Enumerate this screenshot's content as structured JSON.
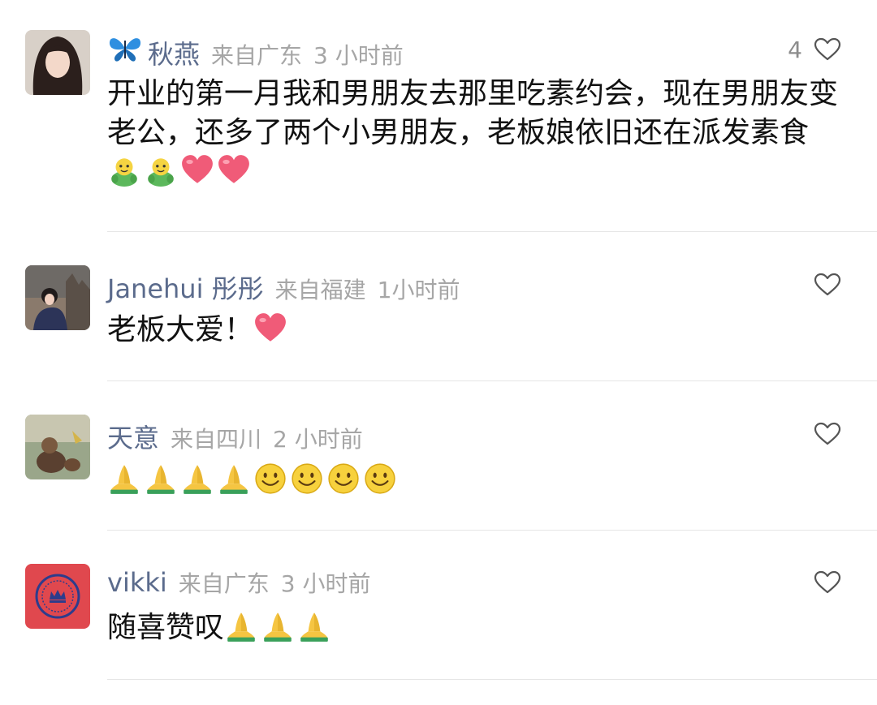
{
  "comments": [
    {
      "name": "秋燕",
      "name_prefix_icon": "butterfly-icon",
      "location": "来自广东",
      "time": "3 小时前",
      "likes": "4",
      "text": "开业的第一月我和男朋友去那里吃素约会，现在男朋友变老公，还多了两个小男朋友，老板娘依旧还在派发素食",
      "emojis": [
        "frog-emoji",
        "frog-emoji",
        "heart-emoji",
        "heart-emoji"
      ]
    },
    {
      "name": "Janehui 彤彤",
      "location": "来自福建",
      "time": "1小时前",
      "text": "老板大爱！",
      "emojis": [
        "heart-emoji"
      ]
    },
    {
      "name": "天意",
      "location": "来自四川",
      "time": "2 小时前",
      "text": "",
      "emojis": [
        "pray-emoji",
        "pray-emoji",
        "pray-emoji",
        "pray-emoji",
        "smile-emoji",
        "smile-emoji",
        "smile-emoji",
        "smile-emoji"
      ]
    },
    {
      "name": "vikki",
      "location": "来自广东",
      "time": "3 小时前",
      "text": "随喜赞叹",
      "emojis": [
        "pray-emoji",
        "pray-emoji",
        "pray-emoji"
      ]
    }
  ],
  "colors": {
    "name": "#5b6b8c",
    "meta": "#a6a6a6",
    "heart": "#f05b78",
    "divider": "#e6e6e6"
  }
}
